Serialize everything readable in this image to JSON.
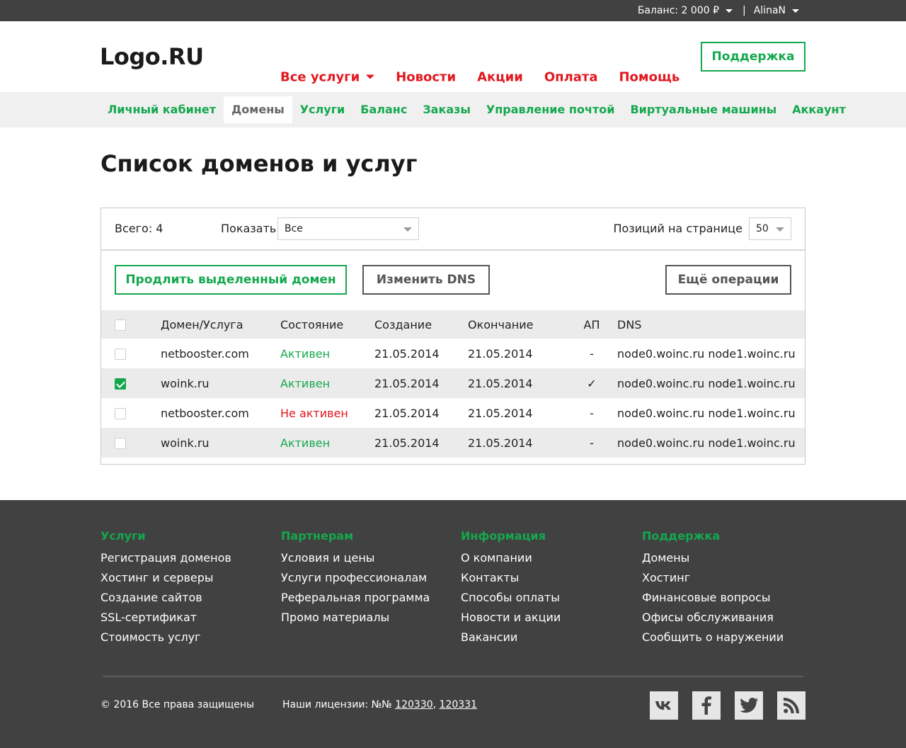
{
  "topbar": {
    "balance": "Баланс: 2 000 ₽",
    "separator": "|",
    "user": "AlinaN"
  },
  "header": {
    "logo": "Logo.RU",
    "nav": [
      "Все услуги",
      "Новости",
      "Акции",
      "Оплата",
      "Помощь"
    ],
    "support_button": "Поддержка"
  },
  "subnav": {
    "items": [
      "Личный кабинет",
      "Домены",
      "Услуги",
      "Баланс",
      "Заказы",
      "Управление почтой",
      "Виртуальные машины",
      "Аккаунт"
    ],
    "active": "Домены"
  },
  "page": {
    "title": "Список доменов и услуг"
  },
  "panel": {
    "total": "Всего: 4",
    "show_label": "Показать",
    "show_value": "Все",
    "perpage_label": "Позиций на странице",
    "perpage_value": "50",
    "buttons": {
      "renew": "Продлить выделенный домен",
      "dns": "Изменить DNS",
      "more": "Ещё операции"
    },
    "columns": [
      "Домен/Услуга",
      "Состояние",
      "Создание",
      "Окончание",
      "АП",
      "DNS"
    ],
    "rows": [
      {
        "checked": false,
        "domain": "netbooster.com",
        "state": "Активен",
        "active": true,
        "created": "21.05.2014",
        "ends": "21.05.2014",
        "ap": "-",
        "dns": "node0.woinc.ru node1.woinc.ru"
      },
      {
        "checked": true,
        "domain": "woink.ru",
        "state": "Активен",
        "active": true,
        "created": "21.05.2014",
        "ends": "21.05.2014",
        "ap": "✓",
        "dns": "node0.woinc.ru node1.woinc.ru"
      },
      {
        "checked": false,
        "domain": "netbooster.com",
        "state": "Не активен",
        "active": false,
        "created": "21.05.2014",
        "ends": "21.05.2014",
        "ap": "-",
        "dns": "node0.woinc.ru node1.woinc.ru"
      },
      {
        "checked": false,
        "domain": "woink.ru",
        "state": "Активен",
        "active": true,
        "created": "21.05.2014",
        "ends": "21.05.2014",
        "ap": "-",
        "dns": "node0.woinc.ru node1.woinc.ru"
      }
    ]
  },
  "footer": {
    "columns": [
      {
        "title": "Услуги",
        "links": [
          "Регистрация доменов",
          "Хостинг и серверы",
          "Создание сайтов",
          "SSL-сертификат",
          "Стоимость услуг"
        ]
      },
      {
        "title": "Партнерам",
        "links": [
          "Условия и цены",
          "Услуги профессионалам",
          "Реферальная программа",
          "Промо материалы"
        ]
      },
      {
        "title": "Информация",
        "links": [
          "О компании",
          "Контакты",
          "Способы оплаты",
          "Новости и акции",
          "Вакансии"
        ]
      },
      {
        "title": "Поддержка",
        "links": [
          "Домены",
          "Хостинг",
          "Финансовые вопросы",
          "Офисы обслуживания",
          "Сообщить о наружении"
        ]
      }
    ],
    "copyright": "© 2016 Все права защищены",
    "licenses_label": "Наши лицензии: №№",
    "license_1": "120330",
    "license_comma": ",",
    "license_2": "120331",
    "social": [
      "vk-icon",
      "facebook-icon",
      "twitter-icon",
      "rss-icon"
    ]
  },
  "colors": {
    "accent_green": "#14a84e",
    "accent_red": "#e2171f",
    "dark": "#414141"
  }
}
